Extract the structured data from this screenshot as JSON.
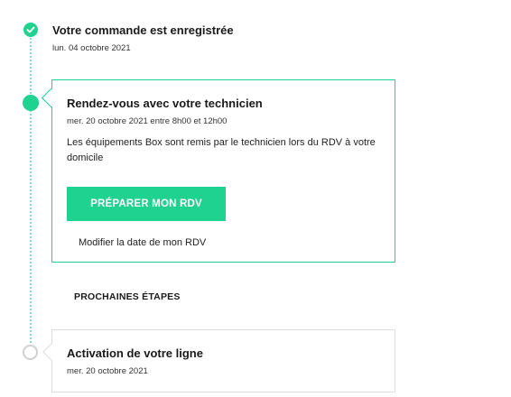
{
  "steps": {
    "done": {
      "title": "Votre commande est enregistrée",
      "date": "lun. 04 octobre 2021"
    },
    "active": {
      "title": "Rendez-vous avec votre technicien",
      "date": "mer. 20 octobre 2021 entre 8h00 et 12h00",
      "description": "Les équipements Box sont remis par le technicien lors du RDV à votre domicile",
      "button_label": "PRÉPARER MON RDV",
      "link_label": "Modifier la date de mon RDV"
    },
    "next_heading": "PROCHAINES ÉTAPES",
    "pending": {
      "title": "Activation de votre ligne",
      "date": "mer. 20 octobre 2021"
    }
  },
  "colors": {
    "accent": "#1fd28f",
    "timeline_line": "#7fe3c4",
    "pending_border": "#d0d0d0"
  },
  "icons": {
    "done_marker": "check-icon"
  }
}
